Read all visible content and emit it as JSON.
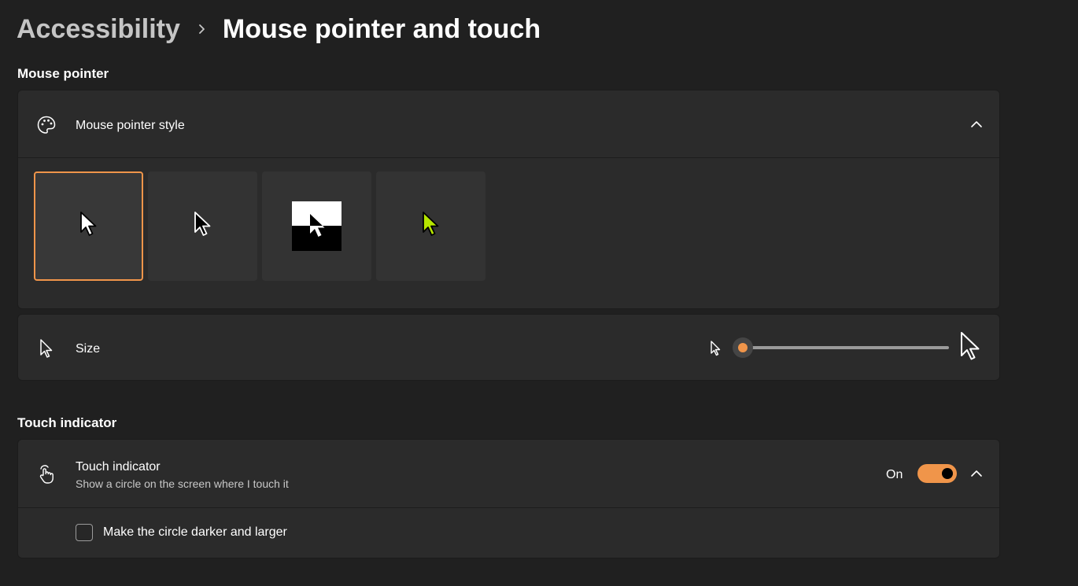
{
  "breadcrumb": {
    "parent": "Accessibility",
    "separator_icon": "chevron-right-icon",
    "current": "Mouse pointer and touch"
  },
  "mouse_pointer_section": {
    "title": "Mouse pointer",
    "style_card": {
      "icon": "palette-icon",
      "label": "Mouse pointer style",
      "expanded": true,
      "styles": [
        {
          "name": "white",
          "selected": true,
          "color": "#ffffff"
        },
        {
          "name": "black",
          "selected": false,
          "color": "#000000"
        },
        {
          "name": "inverted",
          "selected": false
        },
        {
          "name": "custom",
          "selected": false,
          "color": "#b6e600"
        }
      ],
      "accent_color": "#f0954a"
    },
    "size_card": {
      "icon": "pointer-icon",
      "label": "Size",
      "slider": {
        "min": 1,
        "max": 15,
        "value": 1
      }
    }
  },
  "touch_section": {
    "title": "Touch indicator",
    "touch_card": {
      "icon": "touch-hand-icon",
      "label": "Touch indicator",
      "description": "Show a circle on the screen where I touch it",
      "toggle_state": "On",
      "toggle_on": true,
      "expanded": true,
      "option": {
        "label": "Make the circle darker and larger",
        "checked": false
      }
    }
  }
}
